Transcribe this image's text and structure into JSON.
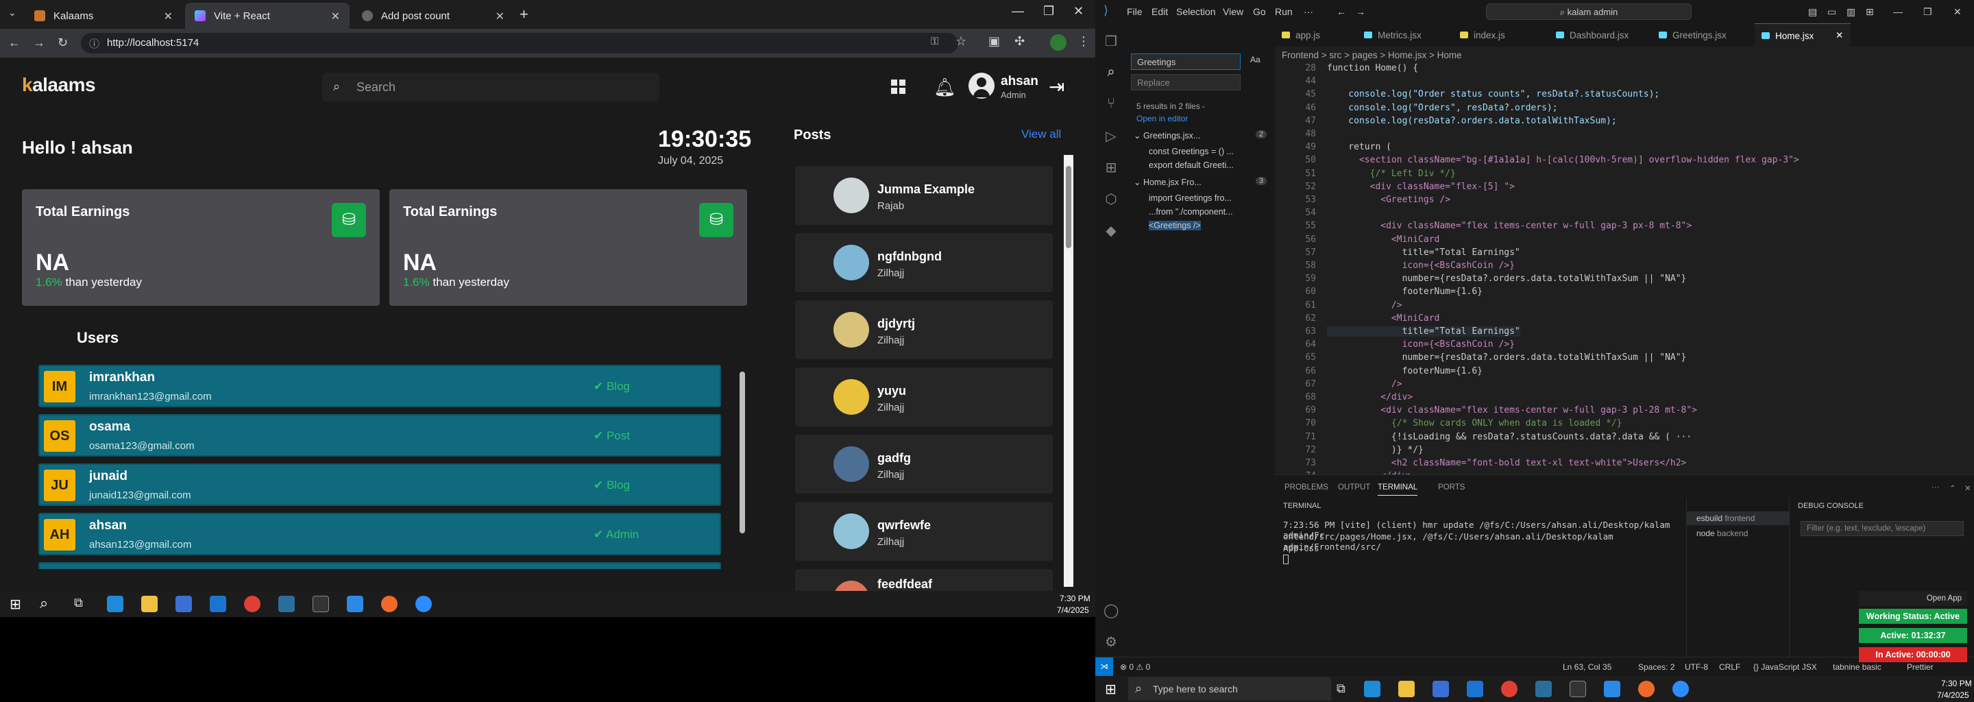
{
  "browser": {
    "tabs": [
      {
        "title": "Kalaams",
        "active": false
      },
      {
        "title": "Vite + React",
        "active": true
      },
      {
        "title": "Add post count",
        "active": false
      }
    ],
    "url": "http://localhost:5174"
  },
  "app": {
    "logo_prefix": "k",
    "logo_text": "alaams",
    "search_placeholder": "Search",
    "user": {
      "name": "ahsan",
      "role": "Admin"
    },
    "greeting": "Hello ! ahsan",
    "clock": "19:30:35",
    "date": "July 04, 2025",
    "cards": [
      {
        "title": "Total Earnings",
        "value": "NA",
        "change": "1.6%",
        "change_suffix": " than yesterday"
      },
      {
        "title": "Total Earnings",
        "value": "NA",
        "change": "1.6%",
        "change_suffix": " than yesterday"
      }
    ],
    "users_heading": "Users",
    "users": [
      {
        "initials": "IM",
        "name": "imrankhan",
        "email": "imrankhan123@gmail.com",
        "role": "Blog"
      },
      {
        "initials": "OS",
        "name": "osama",
        "email": "osama123@gmail.com",
        "role": "Post"
      },
      {
        "initials": "JU",
        "name": "junaid",
        "email": "junaid123@gmail.com",
        "role": "Blog"
      },
      {
        "initials": "AH",
        "name": "ahsan",
        "email": "ahsan123@gmail.com",
        "role": "Admin"
      }
    ],
    "posts_heading": "Posts",
    "view_all": "View all",
    "posts": [
      {
        "title": "Jumma Example",
        "author": "Rajab",
        "color": "#cfd6d8"
      },
      {
        "title": "ngfdnbgnd",
        "author": "Zilhajj",
        "color": "#7fb6d6"
      },
      {
        "title": "djdyrtj",
        "author": "Zilhajj",
        "color": "#d9c27a"
      },
      {
        "title": "yuyu",
        "author": "Zilhajj",
        "color": "#e8c23a"
      },
      {
        "title": "gadfg",
        "author": "Zilhajj",
        "color": "#4d6f93"
      },
      {
        "title": "qwrfewfe",
        "author": "Zilhajj",
        "color": "#8fc4d8"
      },
      {
        "title": "feedfdeaf",
        "author": "",
        "color": "#d9745a"
      }
    ]
  },
  "vscode": {
    "menu": [
      "File",
      "Edit",
      "Selection",
      "View",
      "Go",
      "Run",
      "···"
    ],
    "search_box": "kalam admin",
    "sidebar": {
      "search_value": "Greetings",
      "replace_placeholder": "Replace",
      "summary": "5 results in 2 files -",
      "open_in_editor": "Open in editor",
      "results": [
        {
          "file": "Greetings.jsx...",
          "count": "2",
          "lines": [
            "const Greetings = () ...",
            "export default Greeti..."
          ]
        },
        {
          "file": "Home.jsx Fro...",
          "count": "3",
          "lines": [
            "import Greetings fro...",
            "...from \"./component...",
            "<Greetings />"
          ]
        }
      ]
    },
    "tabs": [
      "app.js",
      "Metrics.jsx",
      "index.js",
      "Dashboard.jsx",
      "Greetings.jsx",
      "Home.jsx"
    ],
    "breadcrumb": "Frontend > src > pages > Home.jsx > Home",
    "code_lines": [
      {
        "n": "28",
        "t": "function Home() {"
      },
      {
        "n": "44",
        "t": ""
      },
      {
        "n": "45",
        "t": "    console.log(\"Order status counts\", resData?.statusCounts);"
      },
      {
        "n": "46",
        "t": "    console.log(\"Orders\", resData?.orders);"
      },
      {
        "n": "47",
        "t": "    console.log(resData?.orders.data.totalWithTaxSum);"
      },
      {
        "n": "48",
        "t": ""
      },
      {
        "n": "49",
        "t": "    return ("
      },
      {
        "n": "50",
        "t": "      <section className=\"bg-[#1a1a1a] h-[calc(100vh-5rem)] overflow-hidden flex gap-3\">"
      },
      {
        "n": "51",
        "t": "        {/* Left Div */}"
      },
      {
        "n": "52",
        "t": "        <div className=\"flex-[5] \">"
      },
      {
        "n": "53",
        "t": "          <Greetings />"
      },
      {
        "n": "54",
        "t": ""
      },
      {
        "n": "55",
        "t": "          <div className=\"flex items-center w-full gap-3 px-8 mt-8\">"
      },
      {
        "n": "56",
        "t": "            <MiniCard"
      },
      {
        "n": "57",
        "t": "              title=\"Total Earnings\""
      },
      {
        "n": "58",
        "t": "              icon={<BsCashCoin />}"
      },
      {
        "n": "59",
        "t": "              number={resData?.orders.data.totalWithTaxSum || \"NA\"}"
      },
      {
        "n": "60",
        "t": "              footerNum={1.6}"
      },
      {
        "n": "61",
        "t": "            />"
      },
      {
        "n": "62",
        "t": "            <MiniCard"
      },
      {
        "n": "63",
        "t": "              title=\"Total Earnings\""
      },
      {
        "n": "64",
        "t": "              icon={<BsCashCoin />}"
      },
      {
        "n": "65",
        "t": "              number={resData?.orders.data.totalWithTaxSum || \"NA\"}"
      },
      {
        "n": "66",
        "t": "              footerNum={1.6}"
      },
      {
        "n": "67",
        "t": "            />"
      },
      {
        "n": "68",
        "t": "          </div>"
      },
      {
        "n": "69",
        "t": "          <div className=\"flex items-center w-full gap-3 pl-28 mt-8\">"
      },
      {
        "n": "70",
        "t": "            {/* Show cards ONLY when data is loaded */}"
      },
      {
        "n": "71",
        "t": "            {!isLoading && resData?.statusCounts.data?.data && ( ···"
      },
      {
        "n": "72",
        "t": "            )} */}"
      },
      {
        "n": "73",
        "t": "            <h2 className=\"font-bold text-xl text-white\">Users</h2>"
      },
      {
        "n": "74",
        "t": "          </div>"
      }
    ],
    "panel_tabs": [
      "PROBLEMS",
      "OUTPUT",
      "TERMINAL",
      "PORTS"
    ],
    "terminal_title": "TERMINAL",
    "terminal_lines": [
      "7:23:56 PM [vite] (client) hmr update /@fs/C:/Users/ahsan.ali/Desktop/kalam admin/Fr",
      "ontend/src/pages/Home.jsx, /@fs/C:/Users/ahsan.ali/Desktop/kalam admin/Frontend/src/",
      "App.css"
    ],
    "terminals": [
      {
        "name": "esbuild",
        "label": "frontend"
      },
      {
        "name": "node",
        "label": "backend"
      }
    ],
    "debug_title": "DEBUG CONSOLE",
    "debug_filter": "Filter (e.g. text, !exclude, \\escape)",
    "status": {
      "left": "⊗ 0 ⚠ 0",
      "position": "Ln 63, Col 35",
      "spaces": "Spaces: 2",
      "encoding": "UTF-8",
      "eol": "CRLF",
      "language": "{} JavaScript JSX",
      "tabnine": "tabnine basic",
      "prettier": "Prettier"
    }
  },
  "widget": {
    "open_app": "Open App",
    "working": "Working Status: Active",
    "active": "Active: 01:32:37",
    "inactive": "In Active: 00:00:00"
  },
  "taskbar": {
    "search_placeholder": "Type here to search",
    "time1": "7:30 PM",
    "date1": "7/4/2025",
    "time2": "7:30 PM",
    "date2": "7/4/2025"
  }
}
